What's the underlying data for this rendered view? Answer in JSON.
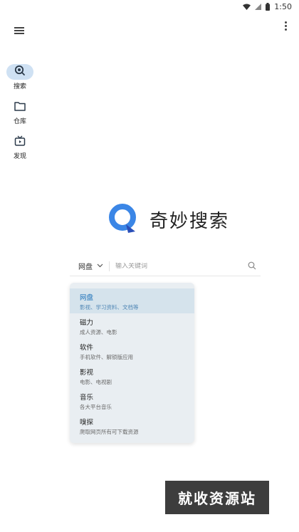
{
  "status_bar": {
    "time": "1:50"
  },
  "rail": {
    "items": [
      {
        "label": "搜索",
        "icon": "search-icon",
        "active": true
      },
      {
        "label": "仓库",
        "icon": "folder-icon",
        "active": false
      },
      {
        "label": "发现",
        "icon": "discover-icon",
        "active": false
      }
    ]
  },
  "brand": {
    "name": "奇妙搜索",
    "accent": "#3b86e6"
  },
  "search": {
    "scope": "网盘",
    "placeholder": "输入关键词"
  },
  "dropdown": {
    "items": [
      {
        "title": "网盘",
        "subtitle": "影视、学习资料、文档等"
      },
      {
        "title": "磁力",
        "subtitle": "成人资源、电影"
      },
      {
        "title": "软件",
        "subtitle": "手机软件、解锁版应用"
      },
      {
        "title": "影视",
        "subtitle": "电影、电视剧"
      },
      {
        "title": "音乐",
        "subtitle": "各大平台音乐"
      },
      {
        "title": "嗅探",
        "subtitle": "爬取网页所有可下载资源"
      }
    ]
  },
  "watermark": {
    "text": "就收资源站"
  }
}
